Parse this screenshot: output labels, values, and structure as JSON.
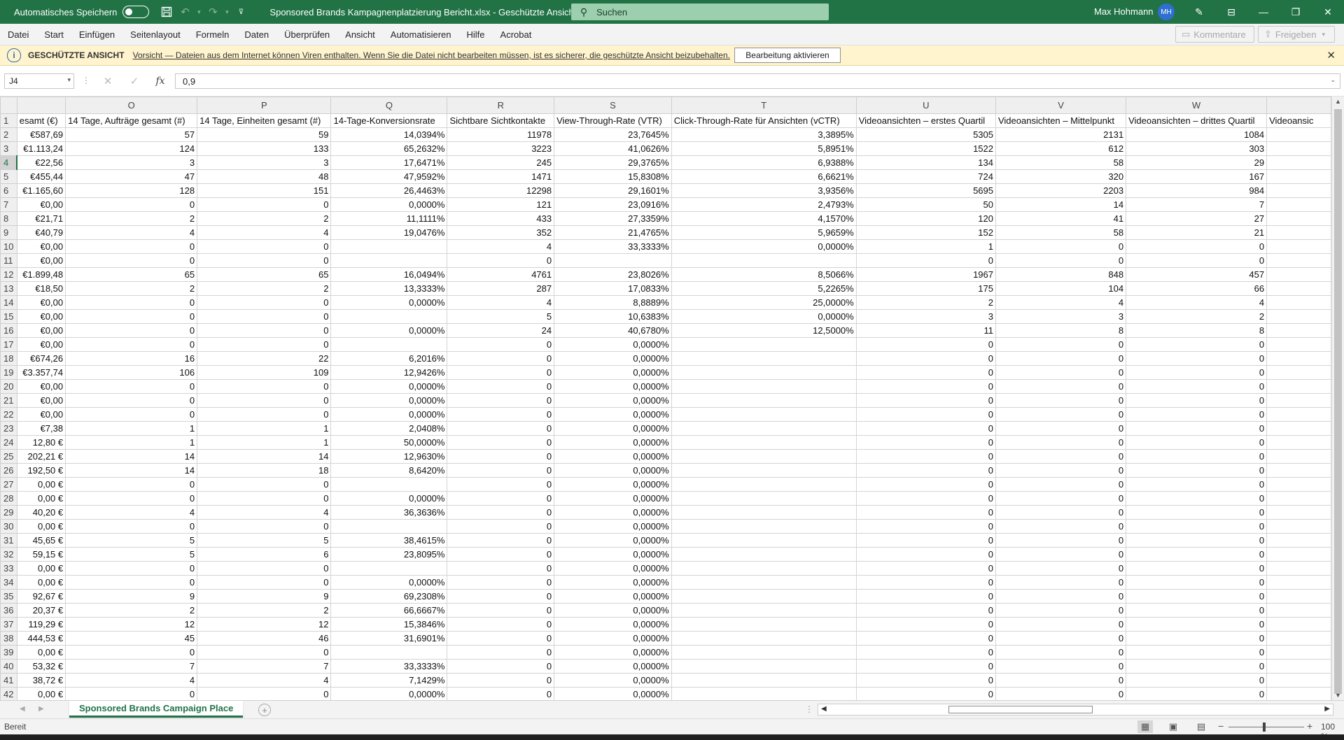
{
  "titlebar": {
    "autosave_label": "Automatisches Speichern",
    "autosave_state": "off",
    "doc_title": "Sponsored Brands Kampagnenplatzierung Bericht.xlsx  -  Geschützte Ansicht",
    "search_placeholder": "Suchen",
    "user_name": "Max Hohmann",
    "user_initials": "MH",
    "accent_color": "#217346"
  },
  "menu": {
    "tabs": [
      "Datei",
      "Start",
      "Einfügen",
      "Seitenlayout",
      "Formeln",
      "Daten",
      "Überprüfen",
      "Ansicht",
      "Automatisieren",
      "Hilfe",
      "Acrobat"
    ],
    "comments_label": "Kommentare",
    "share_label": "Freigeben"
  },
  "protected_view": {
    "title": "GESCHÜTZTE ANSICHT",
    "message": "Vorsicht — Dateien aus dem Internet können Viren enthalten. Wenn Sie die Datei nicht bearbeiten müssen, ist es sicherer, die geschützte Ansicht beizubehalten.",
    "enable_button": "Bearbeitung aktivieren"
  },
  "formula_bar": {
    "name_box": "J4",
    "formula": "0,9"
  },
  "grid": {
    "columns": [
      "",
      "O",
      "P",
      "Q",
      "R",
      "S",
      "T",
      "U",
      "V",
      "W",
      ""
    ],
    "selected_row": "4",
    "header_row": [
      "esamt (€)",
      "14 Tage, Aufträge gesamt (#)",
      "14 Tage, Einheiten gesamt (#)",
      "14-Tage-Konversionsrate",
      "Sichtbare Sichtkontakte",
      "View-Through-Rate (VTR)",
      "Click-Through-Rate für Ansichten (vCTR)",
      "Videoansichten – erstes Quartil",
      "Videoansichten – Mittelpunkt",
      "Videoansichten – drittes Quartil",
      "Videoansic"
    ],
    "rows": [
      [
        "2",
        "€587,69",
        "57",
        "59",
        "14,0394%",
        "11978",
        "23,7645%",
        "3,3895%",
        "5305",
        "2131",
        "1084",
        ""
      ],
      [
        "3",
        "€1.113,24",
        "124",
        "133",
        "65,2632%",
        "3223",
        "41,0626%",
        "5,8951%",
        "1522",
        "612",
        "303",
        ""
      ],
      [
        "4",
        "€22,56",
        "3",
        "3",
        "17,6471%",
        "245",
        "29,3765%",
        "6,9388%",
        "134",
        "58",
        "29",
        ""
      ],
      [
        "5",
        "€455,44",
        "47",
        "48",
        "47,9592%",
        "1471",
        "15,8308%",
        "6,6621%",
        "724",
        "320",
        "167",
        ""
      ],
      [
        "6",
        "€1.165,60",
        "128",
        "151",
        "26,4463%",
        "12298",
        "29,1601%",
        "3,9356%",
        "5695",
        "2203",
        "984",
        ""
      ],
      [
        "7",
        "€0,00",
        "0",
        "0",
        "0,0000%",
        "121",
        "23,0916%",
        "2,4793%",
        "50",
        "14",
        "7",
        ""
      ],
      [
        "8",
        "€21,71",
        "2",
        "2",
        "11,1111%",
        "433",
        "27,3359%",
        "4,1570%",
        "120",
        "41",
        "27",
        ""
      ],
      [
        "9",
        "€40,79",
        "4",
        "4",
        "19,0476%",
        "352",
        "21,4765%",
        "5,9659%",
        "152",
        "58",
        "21",
        ""
      ],
      [
        "10",
        "€0,00",
        "0",
        "0",
        "",
        "4",
        "33,3333%",
        "0,0000%",
        "1",
        "0",
        "0",
        ""
      ],
      [
        "11",
        "€0,00",
        "0",
        "0",
        "",
        "0",
        "",
        "",
        "0",
        "0",
        "0",
        ""
      ],
      [
        "12",
        "€1.899,48",
        "65",
        "65",
        "16,0494%",
        "4761",
        "23,8026%",
        "8,5066%",
        "1967",
        "848",
        "457",
        ""
      ],
      [
        "13",
        "€18,50",
        "2",
        "2",
        "13,3333%",
        "287",
        "17,0833%",
        "5,2265%",
        "175",
        "104",
        "66",
        ""
      ],
      [
        "14",
        "€0,00",
        "0",
        "0",
        "0,0000%",
        "4",
        "8,8889%",
        "25,0000%",
        "2",
        "4",
        "4",
        ""
      ],
      [
        "15",
        "€0,00",
        "0",
        "0",
        "",
        "5",
        "10,6383%",
        "0,0000%",
        "3",
        "3",
        "2",
        ""
      ],
      [
        "16",
        "€0,00",
        "0",
        "0",
        "0,0000%",
        "24",
        "40,6780%",
        "12,5000%",
        "11",
        "8",
        "8",
        ""
      ],
      [
        "17",
        "€0,00",
        "0",
        "0",
        "",
        "0",
        "0,0000%",
        "",
        "0",
        "0",
        "0",
        ""
      ],
      [
        "18",
        "€674,26",
        "16",
        "22",
        "6,2016%",
        "0",
        "0,0000%",
        "",
        "0",
        "0",
        "0",
        ""
      ],
      [
        "19",
        "€3.357,74",
        "106",
        "109",
        "12,9426%",
        "0",
        "0,0000%",
        "",
        "0",
        "0",
        "0",
        ""
      ],
      [
        "20",
        "€0,00",
        "0",
        "0",
        "0,0000%",
        "0",
        "0,0000%",
        "",
        "0",
        "0",
        "0",
        ""
      ],
      [
        "21",
        "€0,00",
        "0",
        "0",
        "0,0000%",
        "0",
        "0,0000%",
        "",
        "0",
        "0",
        "0",
        ""
      ],
      [
        "22",
        "€0,00",
        "0",
        "0",
        "0,0000%",
        "0",
        "0,0000%",
        "",
        "0",
        "0",
        "0",
        ""
      ],
      [
        "23",
        "€7,38",
        "1",
        "1",
        "2,0408%",
        "0",
        "0,0000%",
        "",
        "0",
        "0",
        "0",
        ""
      ],
      [
        "24",
        "12,80 €",
        "1",
        "1",
        "50,0000%",
        "0",
        "0,0000%",
        "",
        "0",
        "0",
        "0",
        ""
      ],
      [
        "25",
        "202,21 €",
        "14",
        "14",
        "12,9630%",
        "0",
        "0,0000%",
        "",
        "0",
        "0",
        "0",
        ""
      ],
      [
        "26",
        "192,50 €",
        "14",
        "18",
        "8,6420%",
        "0",
        "0,0000%",
        "",
        "0",
        "0",
        "0",
        ""
      ],
      [
        "27",
        "0,00 €",
        "0",
        "0",
        "",
        "0",
        "0,0000%",
        "",
        "0",
        "0",
        "0",
        ""
      ],
      [
        "28",
        "0,00 €",
        "0",
        "0",
        "0,0000%",
        "0",
        "0,0000%",
        "",
        "0",
        "0",
        "0",
        ""
      ],
      [
        "29",
        "40,20 €",
        "4",
        "4",
        "36,3636%",
        "0",
        "0,0000%",
        "",
        "0",
        "0",
        "0",
        ""
      ],
      [
        "30",
        "0,00 €",
        "0",
        "0",
        "",
        "0",
        "0,0000%",
        "",
        "0",
        "0",
        "0",
        ""
      ],
      [
        "31",
        "45,65 €",
        "5",
        "5",
        "38,4615%",
        "0",
        "0,0000%",
        "",
        "0",
        "0",
        "0",
        ""
      ],
      [
        "32",
        "59,15 €",
        "5",
        "6",
        "23,8095%",
        "0",
        "0,0000%",
        "",
        "0",
        "0",
        "0",
        ""
      ],
      [
        "33",
        "0,00 €",
        "0",
        "0",
        "",
        "0",
        "0,0000%",
        "",
        "0",
        "0",
        "0",
        ""
      ],
      [
        "34",
        "0,00 €",
        "0",
        "0",
        "0,0000%",
        "0",
        "0,0000%",
        "",
        "0",
        "0",
        "0",
        ""
      ],
      [
        "35",
        "92,67 €",
        "9",
        "9",
        "69,2308%",
        "0",
        "0,0000%",
        "",
        "0",
        "0",
        "0",
        ""
      ],
      [
        "36",
        "20,37 €",
        "2",
        "2",
        "66,6667%",
        "0",
        "0,0000%",
        "",
        "0",
        "0",
        "0",
        ""
      ],
      [
        "37",
        "119,29 €",
        "12",
        "12",
        "15,3846%",
        "0",
        "0,0000%",
        "",
        "0",
        "0",
        "0",
        ""
      ],
      [
        "38",
        "444,53 €",
        "45",
        "46",
        "31,6901%",
        "0",
        "0,0000%",
        "",
        "0",
        "0",
        "0",
        ""
      ],
      [
        "39",
        "0,00 €",
        "0",
        "0",
        "",
        "0",
        "0,0000%",
        "",
        "0",
        "0",
        "0",
        ""
      ],
      [
        "40",
        "53,32 €",
        "7",
        "7",
        "33,3333%",
        "0",
        "0,0000%",
        "",
        "0",
        "0",
        "0",
        ""
      ],
      [
        "41",
        "38,72 €",
        "4",
        "4",
        "7,1429%",
        "0",
        "0,0000%",
        "",
        "0",
        "0",
        "0",
        ""
      ],
      [
        "42",
        "0,00 €",
        "0",
        "0",
        "0,0000%",
        "0",
        "0,0000%",
        "",
        "0",
        "0",
        "0",
        ""
      ]
    ]
  },
  "sheet_tabs": {
    "active": "Sponsored Brands Campaign Place"
  },
  "status_bar": {
    "status": "Bereit",
    "zoom": "100 %"
  }
}
